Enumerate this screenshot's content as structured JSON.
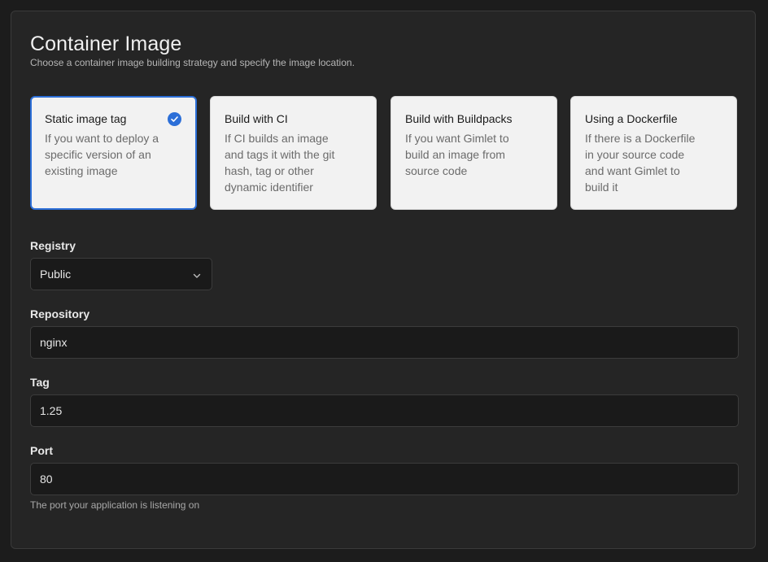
{
  "header": {
    "title": "Container Image",
    "subtitle": "Choose a container image building strategy and specify the image location."
  },
  "strategies": [
    {
      "title": "Static image tag",
      "description": "If you want to deploy a specific version of an existing image",
      "selected": true
    },
    {
      "title": "Build with CI",
      "description": "If CI builds an image and tags it with the git hash, tag or other dynamic identifier",
      "selected": false
    },
    {
      "title": "Build with Buildpacks",
      "description": "If you want Gimlet to build an image from source code",
      "selected": false
    },
    {
      "title": "Using a Dockerfile",
      "description": "If there is a Dockerfile in your source code and want Gimlet to build it",
      "selected": false
    }
  ],
  "registry": {
    "label": "Registry",
    "value": "Public"
  },
  "repository": {
    "label": "Repository",
    "value": "nginx"
  },
  "tag": {
    "label": "Tag",
    "value": "1.25"
  },
  "port": {
    "label": "Port",
    "value": "80",
    "help": "The port your application is listening on"
  },
  "colors": {
    "accent": "#2c6fd8",
    "background": "#252525",
    "card": "#f2f2f2"
  },
  "icons": {
    "selected_marker": "check-circle-icon",
    "select_indicator": "chevron-down-icon"
  }
}
